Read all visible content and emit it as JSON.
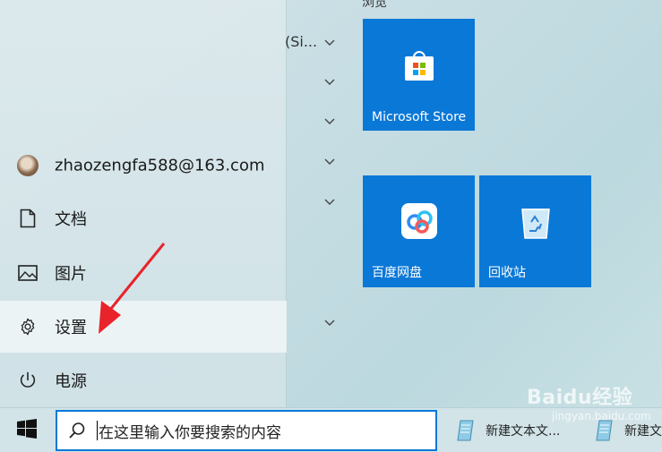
{
  "start_menu": {
    "rail": {
      "account": "zhaozengfa588@163.com",
      "documents": "文档",
      "pictures": "图片",
      "settings": "设置",
      "power": "电源"
    },
    "app_list": {
      "clipped_text": "(Si...",
      "top_clipped_text": "浏览"
    },
    "tiles": {
      "store": "Microsoft Store",
      "baidu_netdisk": "百度网盘",
      "recycle_bin": "回收站"
    }
  },
  "taskbar": {
    "search_placeholder": "在这里输入你要搜索的内容",
    "items": [
      {
        "label": "新建文本文..."
      },
      {
        "label": "新建文"
      }
    ]
  },
  "watermark": {
    "brand": "Baidu经验",
    "url": "jingyan.baidu.com"
  },
  "colors": {
    "tile": "#0a78d7",
    "accent": "#0a78d7",
    "annotation_arrow": "#e8232a"
  }
}
